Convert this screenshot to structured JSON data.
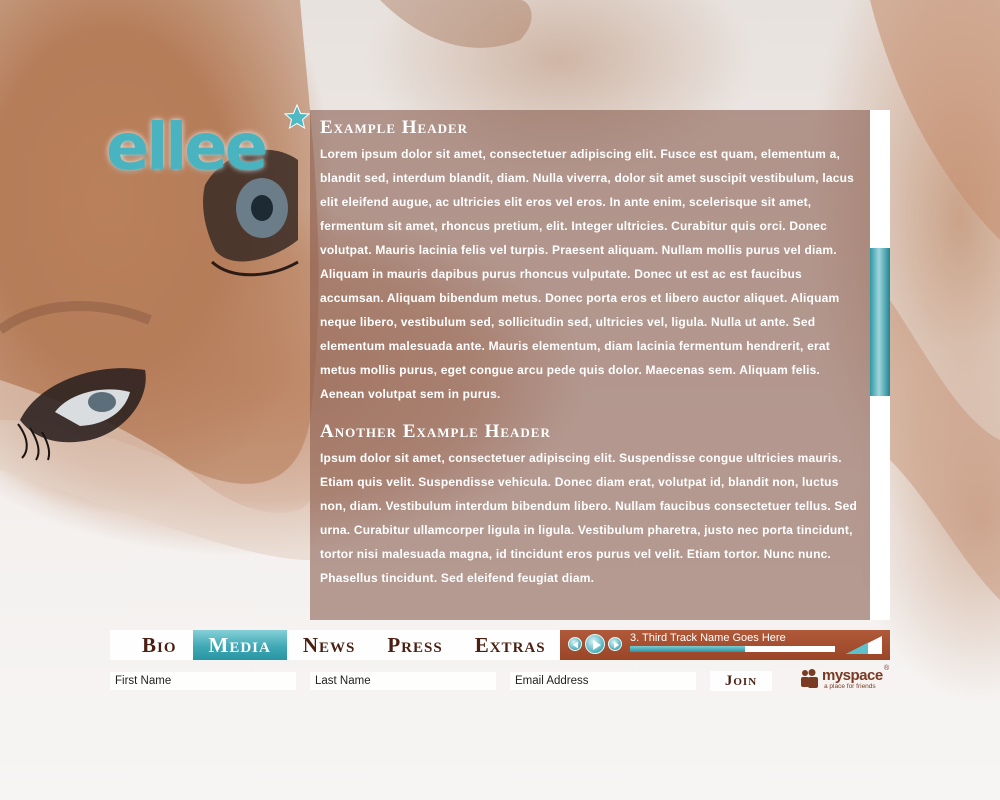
{
  "logo": {
    "text": "ellee"
  },
  "content": {
    "sections": [
      {
        "header": "Example Header",
        "body": "Lorem ipsum dolor sit amet, consectetuer adipiscing elit. Fusce est quam, elementum a, blandit sed, interdum blandit, diam. Nulla viverra, dolor sit amet suscipit vestibulum, lacus elit eleifend augue, ac ultricies elit eros vel eros. In ante enim, scelerisque sit amet, fermentum sit amet, rhoncus pretium, elit. Integer ultricies. Curabitur quis orci. Donec volutpat. Mauris lacinia felis vel turpis. Praesent aliquam. Nullam mollis purus vel diam. Aliquam in mauris dapibus purus rhoncus vulputate. Donec ut est ac est faucibus accumsan. Aliquam bibendum metus. Donec porta eros et libero auctor aliquet. Aliquam neque libero, vestibulum sed, sollicitudin sed, ultricies vel, ligula. Nulla ut ante. Sed elementum malesuada ante. Mauris elementum, diam lacinia fermentum hendrerit, erat metus mollis purus, eget congue arcu pede quis dolor. Maecenas sem. Aliquam felis. Aenean volutpat sem in purus."
      },
      {
        "header": "Another Example Header",
        "body": "Ipsum dolor sit amet, consectetuer adipiscing elit. Suspendisse congue ultricies mauris. Etiam quis velit. Suspendisse vehicula. Donec diam erat, volutpat id, blandit non, luctus non, diam. Vestibulum interdum bibendum libero. Nullam faucibus consectetuer tellus. Sed urna. Curabitur ullamcorper ligula in ligula. Vestibulum pharetra, justo nec porta tincidunt, tortor nisi malesuada magna, id tincidunt eros purus vel velit. Etiam tortor. Nunc nunc. Phasellus tincidunt. Sed eleifend feugiat diam."
      }
    ],
    "scroll_position": 0.27,
    "scroll_visible_fraction": 0.29
  },
  "nav": {
    "items": [
      {
        "label": "Bio",
        "active": false
      },
      {
        "label": "Media",
        "active": true
      },
      {
        "label": "News",
        "active": false
      },
      {
        "label": "Press",
        "active": false
      },
      {
        "label": "Extras",
        "active": false
      }
    ]
  },
  "player": {
    "track": "3. Third Track Name Goes Here",
    "progress": 0.56,
    "icons": [
      "prev-icon",
      "play-icon",
      "next-icon",
      "volume-icon"
    ]
  },
  "signup": {
    "first_name_placeholder": "First Name",
    "last_name_placeholder": "Last Name",
    "email_placeholder": "Email Address",
    "join_label": "Join"
  },
  "myspace": {
    "brand": "myspace",
    "tagline": "a place for friends"
  },
  "colors": {
    "accent": "#3fa9b5",
    "brand_brown": "#9a4527",
    "nav_text": "#4a1f12",
    "panel": "#875a4b"
  }
}
